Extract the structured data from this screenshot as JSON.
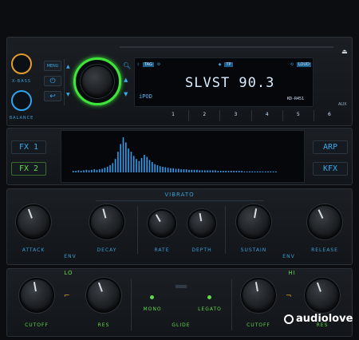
{
  "head_unit": {
    "left_knobs": {
      "top_label": "X-BASS",
      "bottom_label": "BALANCE"
    },
    "buttons": {
      "menu_label": "MENU"
    },
    "display": {
      "station": "SLVST 90.3",
      "model": "KD-R451",
      "icon_labels": {
        "tag": "TAG",
        "band": "TP",
        "loud": "LOUD"
      },
      "ipod_label": "iPOD"
    },
    "preset_numbers": [
      "1",
      "2",
      "3",
      "4",
      "5",
      "6"
    ],
    "aux_label": "AUX"
  },
  "fx_section": {
    "left_buttons": [
      "FX 1",
      "FX 2"
    ],
    "right_buttons": [
      "ARP",
      "KFX"
    ],
    "spectrum_levels": [
      3,
      3,
      4,
      3,
      4,
      5,
      4,
      5,
      6,
      5,
      6,
      7,
      9,
      11,
      14,
      18,
      26,
      40,
      55,
      68,
      58,
      46,
      40,
      32,
      26,
      22,
      28,
      34,
      30,
      24,
      20,
      16,
      14,
      12,
      11,
      10,
      9,
      8,
      8,
      7,
      7,
      6,
      6,
      6,
      5,
      5,
      5,
      5,
      4,
      4,
      4,
      4,
      4,
      4,
      4,
      3,
      3,
      3,
      3,
      3,
      3,
      3,
      3,
      3,
      3,
      2,
      2,
      2,
      2,
      2,
      2,
      2,
      2,
      2,
      2,
      2,
      2,
      2
    ],
    "accent": "#2f9ef0"
  },
  "mod_section": {
    "title": "VIBRATO",
    "knobs": [
      "ATTACK",
      "DECAY",
      "RATE",
      "DEPTH",
      "SUSTAIN",
      "RELEASE"
    ],
    "env_labels": [
      "ENV",
      "ENV"
    ]
  },
  "filter_section": {
    "lo_label": "LO",
    "hi_label": "HI",
    "left_knobs": [
      "CUTOFF",
      "RES"
    ],
    "center_labels": {
      "mono": "MONO",
      "legato": "LEGATO",
      "glide": "GLIDE"
    },
    "right_knobs": [
      "CUTOFF",
      "RES"
    ]
  },
  "watermark": "audiolove"
}
